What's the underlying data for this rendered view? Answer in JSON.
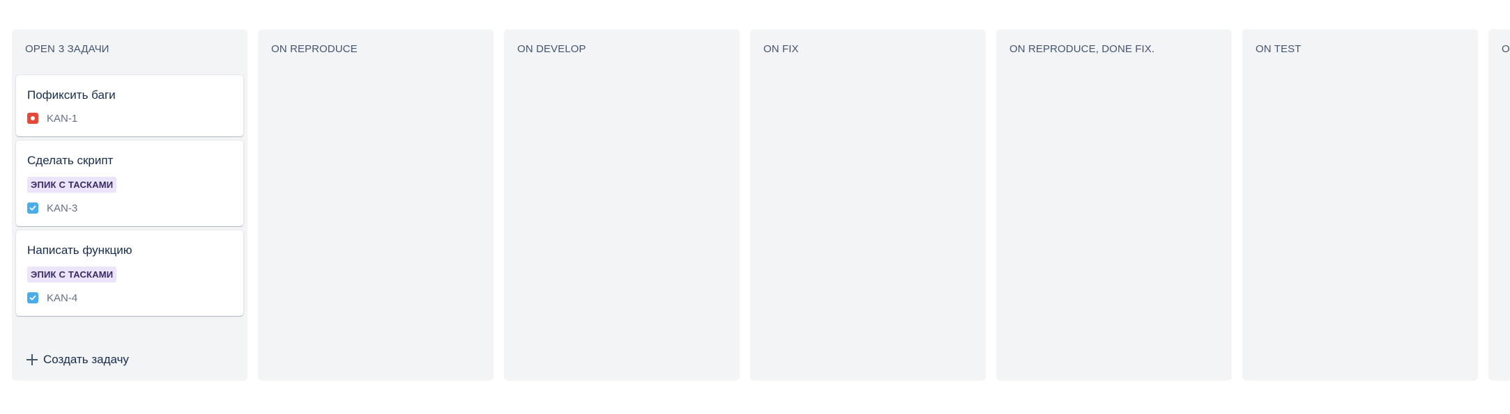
{
  "board": {
    "columns": [
      {
        "title": "OPEN",
        "count": "3 ЗАДАЧИ",
        "cards": [
          {
            "title": "Пофиксить баги",
            "epic": "",
            "type_icon": "bug-icon",
            "key": "KAN-1"
          },
          {
            "title": "Сделать скрипт",
            "epic": "ЭПИК С ТАСКАМИ",
            "type_icon": "task-icon",
            "key": "KAN-3"
          },
          {
            "title": "Написать функцию",
            "epic": "ЭПИК С ТАСКАМИ",
            "type_icon": "task-icon",
            "key": "KAN-4"
          }
        ],
        "create_label": "Создать задачу"
      },
      {
        "title": "ON REPRODUCE"
      },
      {
        "title": "ON DEVELOP"
      },
      {
        "title": "ON FIX"
      },
      {
        "title": "ON REPRODUCE, DONE FIX."
      },
      {
        "title": "ON TEST"
      },
      {
        "title": "ON"
      }
    ]
  },
  "colors": {
    "column_bg": "#f3f4f6",
    "bug_icon": "#e5493a",
    "task_icon": "#4bade8",
    "epic_tag_bg": "#ebe4fb",
    "epic_tag_text": "#352c63"
  }
}
